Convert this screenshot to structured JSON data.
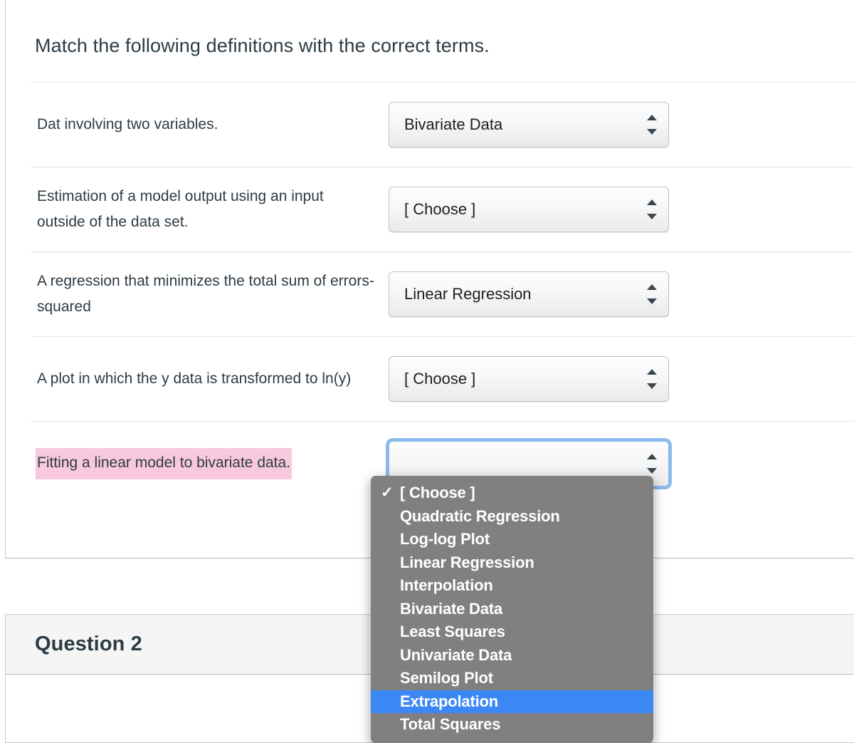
{
  "question1": {
    "prompt": "Match the following definitions with the correct terms.",
    "rows": [
      {
        "definition": "Dat involving two variables.",
        "selected": "Bivariate Data",
        "highlighted": false,
        "focused": false
      },
      {
        "definition": "Estimation of a model output using an input outside of the data set.",
        "selected": "[ Choose ]",
        "highlighted": false,
        "focused": false
      },
      {
        "definition": "A regression that minimizes the total sum of errors-squared",
        "selected": "Linear Regression",
        "highlighted": false,
        "focused": false
      },
      {
        "definition": "A plot in which the y data is transformed to ln(y)",
        "selected": "[ Choose ]",
        "highlighted": false,
        "focused": false
      },
      {
        "definition": "Fitting a linear model to bivariate data.",
        "selected": "",
        "highlighted": true,
        "focused": true
      }
    ]
  },
  "dropdown": {
    "open": true,
    "checked_option": "[ Choose ]",
    "highlighted_option": "Extrapolation",
    "options": [
      "[ Choose ]",
      "Quadratic Regression",
      "Log-log Plot",
      "Linear Regression",
      "Interpolation",
      "Bivariate Data",
      "Least Squares",
      "Univariate Data",
      "Semilog Plot",
      "Extrapolation",
      "Total Squares"
    ]
  },
  "question2": {
    "title": "Question 2"
  },
  "colors": {
    "highlight_pink": "#f8c8dc",
    "dropdown_bg": "#808080",
    "dropdown_highlight_blue": "#3b88f5",
    "focus_ring_blue": "#8bb9ec",
    "text": "#2d3b45",
    "card_header_bg": "#f5f5f5"
  }
}
